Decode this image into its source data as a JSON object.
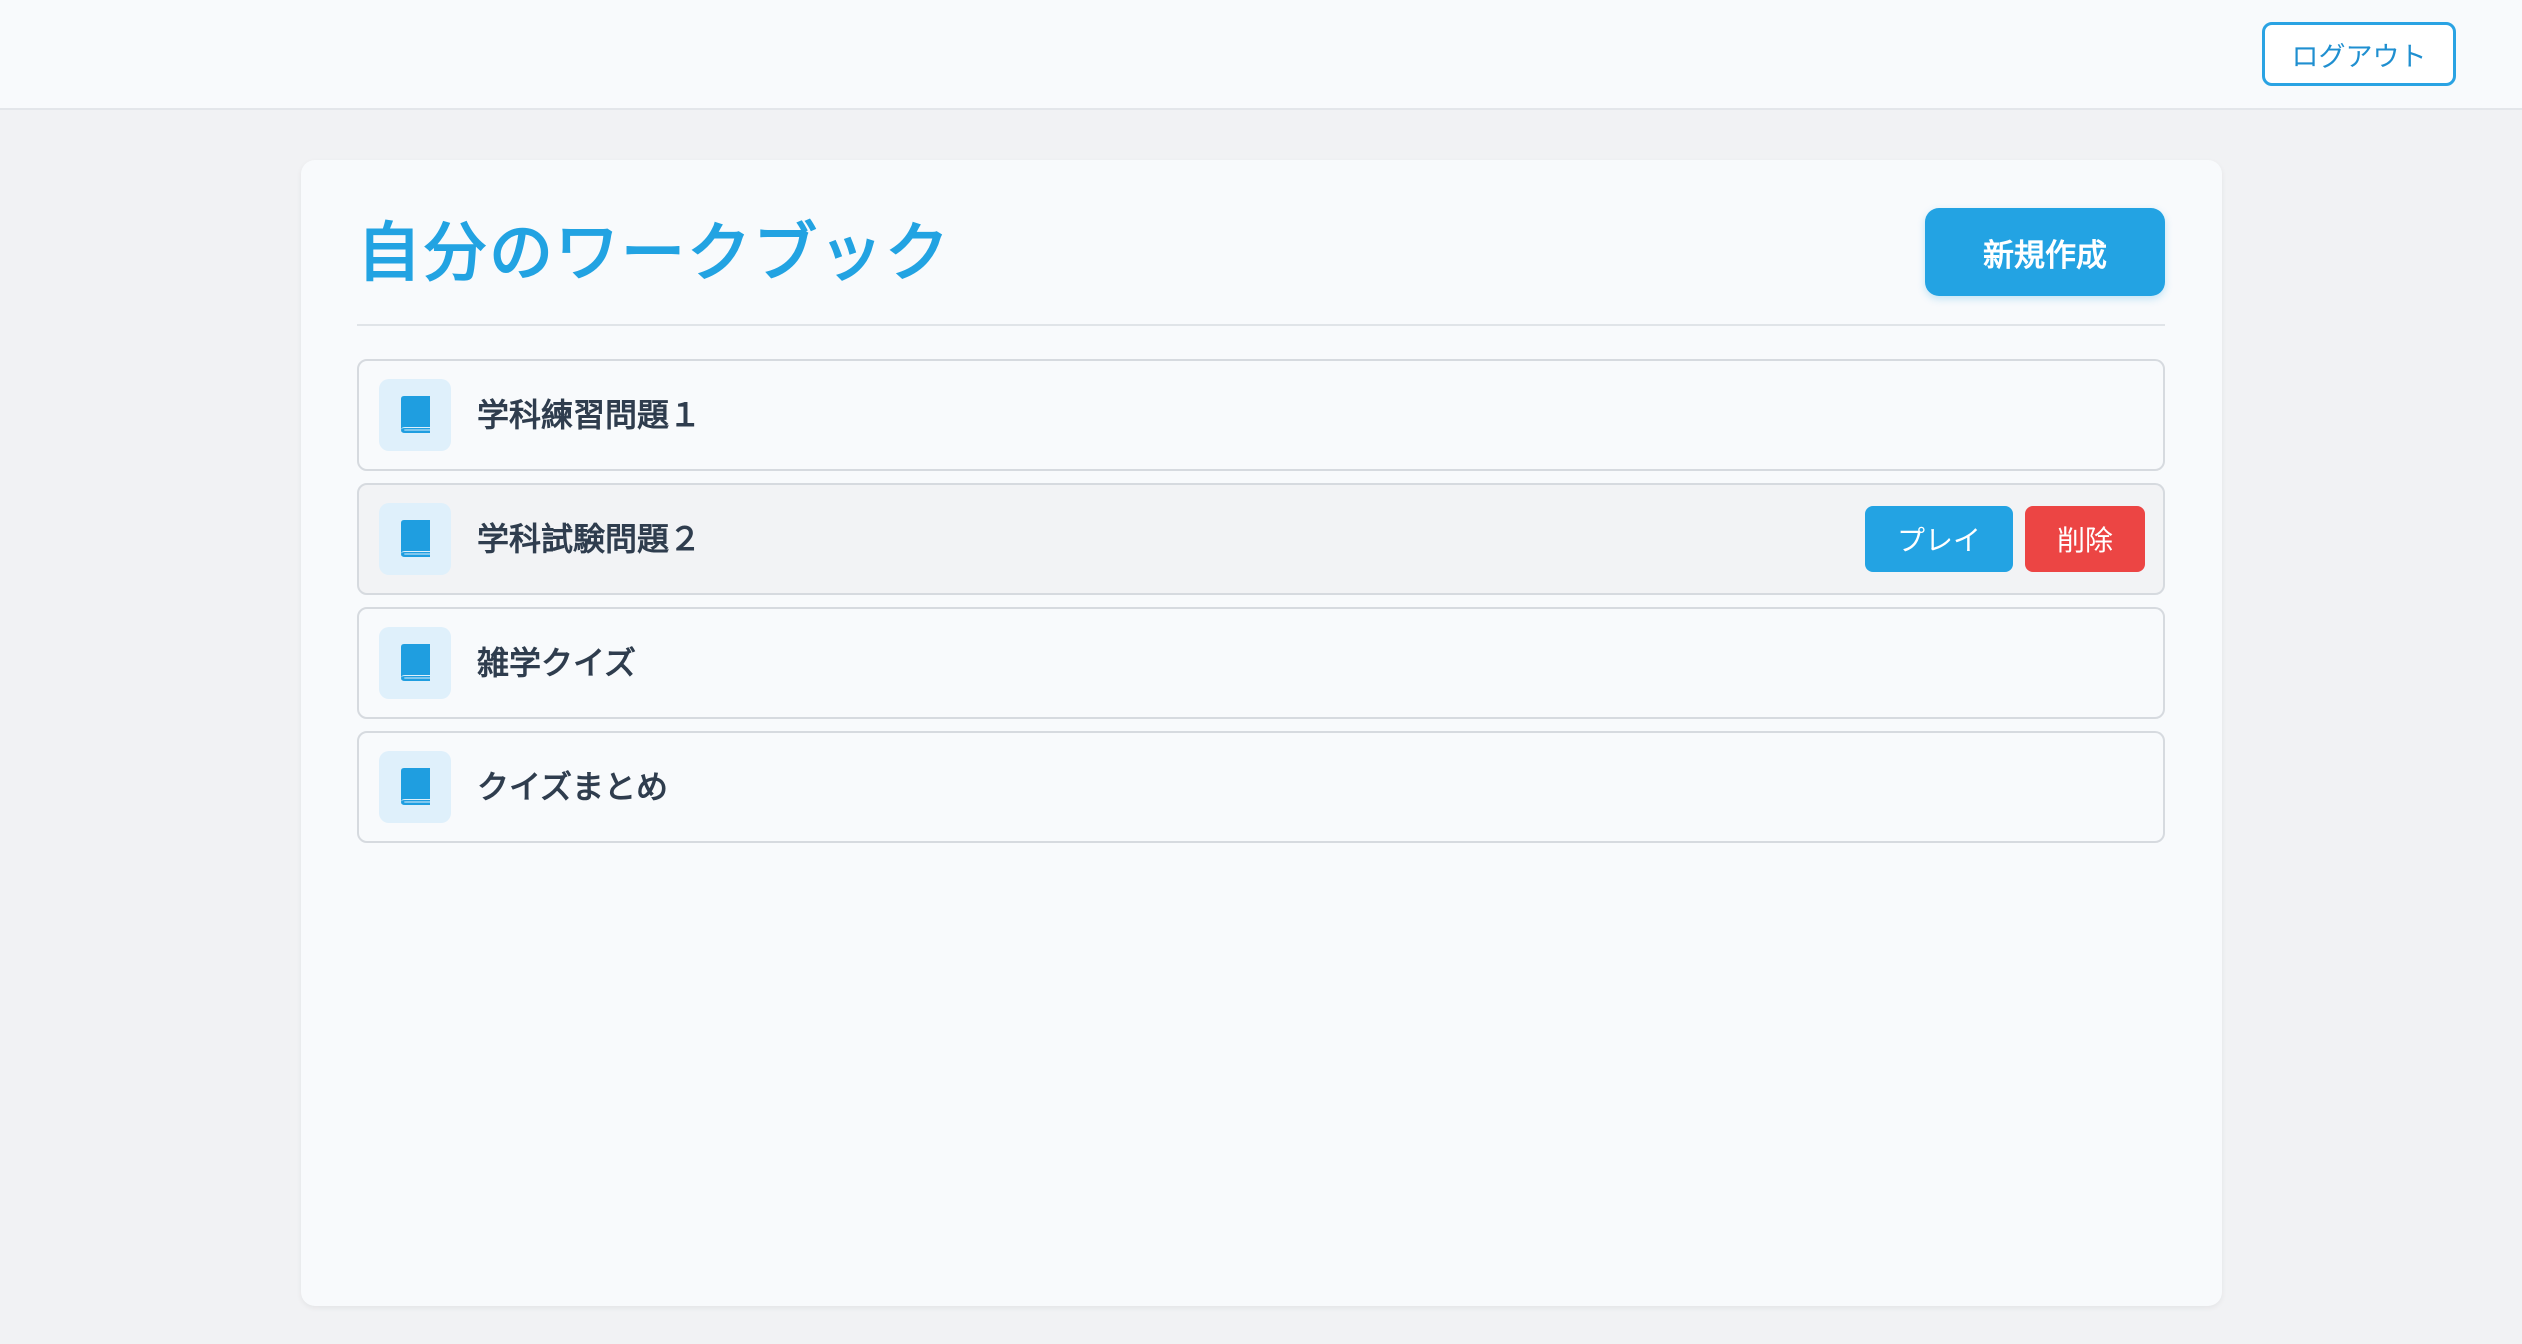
{
  "header": {
    "logout_label": "ログアウト"
  },
  "main": {
    "title": "自分のワークブック",
    "new_button_label": "新規作成",
    "workbooks": [
      {
        "title": "学科練習問題１",
        "icon": "book-icon"
      },
      {
        "title": "学科試験問題２",
        "icon": "book-icon",
        "actions": {
          "play_label": "プレイ",
          "delete_label": "削除"
        }
      },
      {
        "title": "雑学クイズ",
        "icon": "book-icon"
      },
      {
        "title": "クイズまとめ",
        "icon": "book-icon"
      }
    ]
  },
  "colors": {
    "accent": "#23a3e3",
    "danger": "#ec4544",
    "icon_bg": "#dff0fb"
  }
}
